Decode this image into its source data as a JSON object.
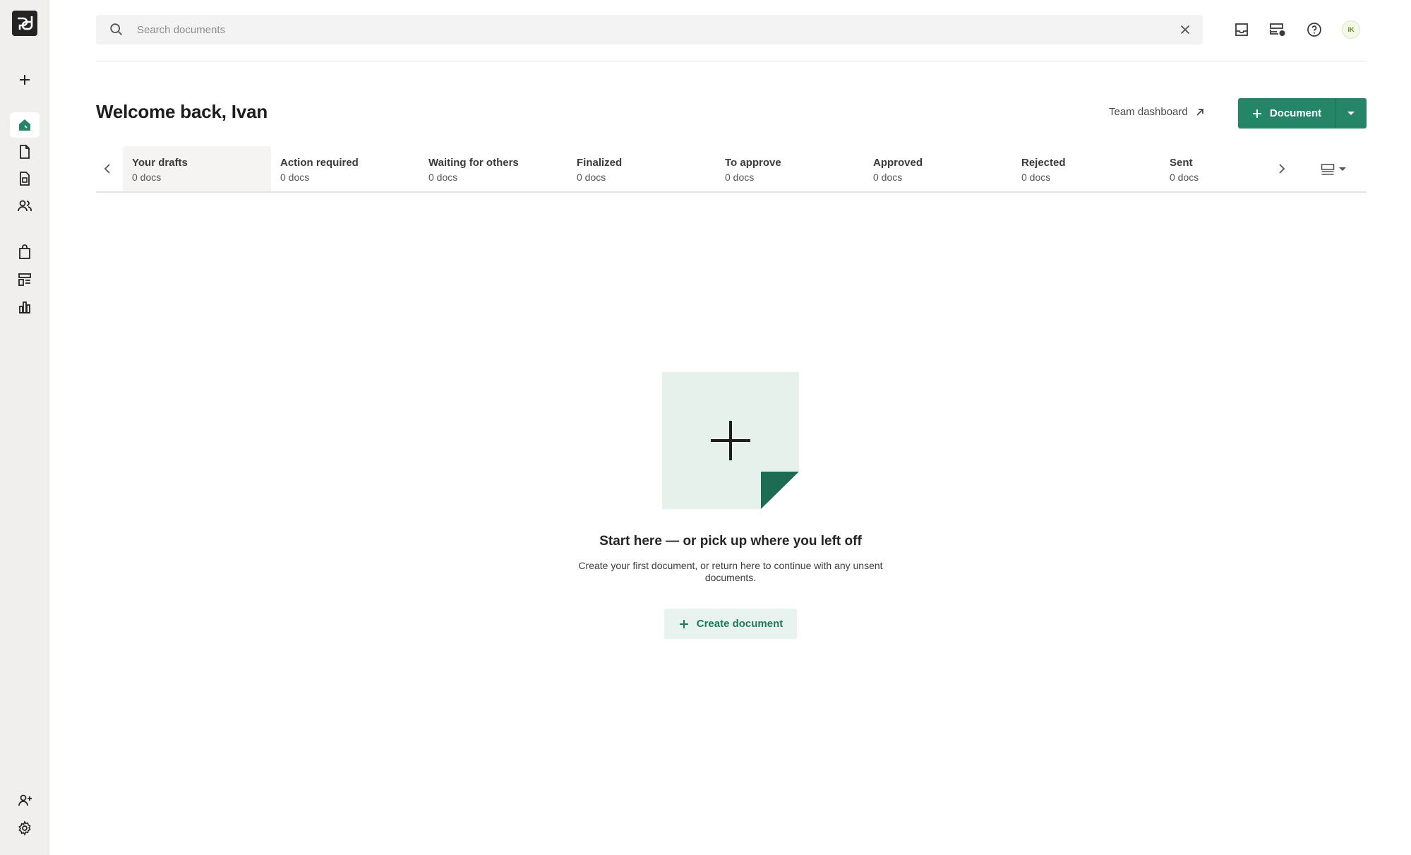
{
  "sidebar": {
    "logo_text": "pd",
    "items": [
      {
        "name": "create-icon",
        "label": "Create"
      },
      {
        "name": "home-icon",
        "label": "Home"
      },
      {
        "name": "documents-icon",
        "label": "Documents"
      },
      {
        "name": "templates-icon",
        "label": "Templates"
      },
      {
        "name": "contacts-icon",
        "label": "Contacts"
      },
      {
        "name": "catalog-icon",
        "label": "Catalog"
      },
      {
        "name": "forms-icon",
        "label": "Forms"
      },
      {
        "name": "reports-icon",
        "label": "Reports"
      },
      {
        "name": "invite-user-icon",
        "label": "Invite"
      },
      {
        "name": "settings-icon",
        "label": "Settings"
      }
    ]
  },
  "search": {
    "placeholder": "Search documents"
  },
  "topbar": {
    "avatar_initials": "IK"
  },
  "header": {
    "title": "Welcome back, Ivan",
    "team_dashboard_label": "Team dashboard",
    "document_button_label": "Document"
  },
  "tabs": [
    {
      "label": "Your drafts",
      "count": "0 docs"
    },
    {
      "label": "Action required",
      "count": "0 docs"
    },
    {
      "label": "Waiting for others",
      "count": "0 docs"
    },
    {
      "label": "Finalized",
      "count": "0 docs"
    },
    {
      "label": "To approve",
      "count": "0 docs"
    },
    {
      "label": "Approved",
      "count": "0 docs"
    },
    {
      "label": "Rejected",
      "count": "0 docs"
    },
    {
      "label": "Sent",
      "count": "0 docs"
    }
  ],
  "empty_state": {
    "title": "Start here — or pick up where you left off",
    "description": "Create your first document, or return here to continue with any unsent documents.",
    "create_button_label": "Create document"
  },
  "colors": {
    "accent": "#248567",
    "accent_dark": "#1c6b53",
    "illustration_bg": "#e6f1ec",
    "sidebar_bg": "#f1efed"
  }
}
